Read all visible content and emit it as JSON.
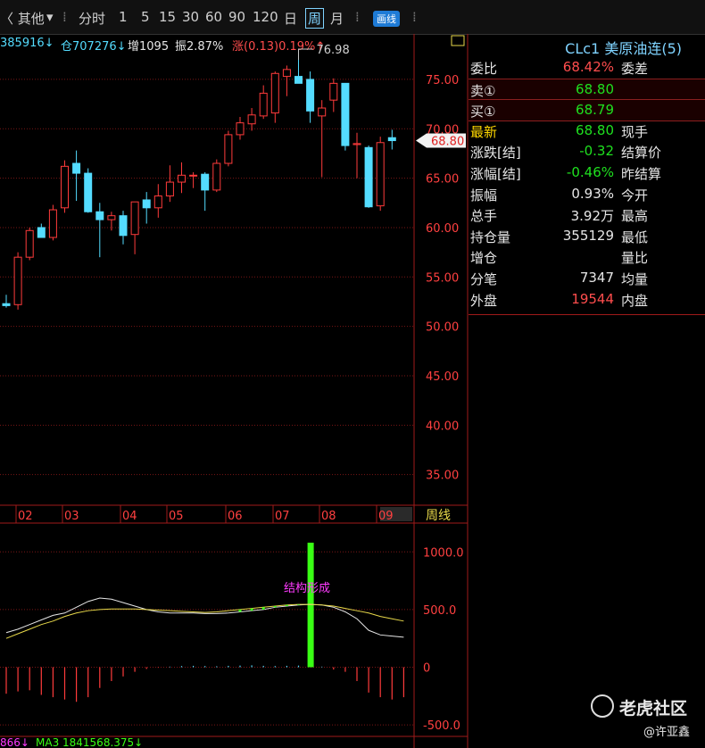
{
  "toolbar": {
    "items": [
      "〈 其他",
      "▾",
      "⁞",
      "分时",
      "1",
      "5",
      "15",
      "30",
      "60",
      "90",
      "120",
      "日",
      "周",
      "月",
      "⁞",
      "画线",
      "⁞"
    ],
    "active": "周"
  },
  "infobar": {
    "vol": "385916↓",
    "oi": "仓707276↓",
    "inc": "增1095",
    "amp": "振2.87%",
    "chg": "涨(0.13)0.19%↑"
  },
  "colors": {
    "up": "#ff3b3b",
    "down": "#54dcff",
    "grid": "#7a1616",
    "ma_white": "#e6e6e6",
    "ma_yellow": "#e8d94a",
    "green_bar": "#39ff14",
    "quote_red": "#ff4d4d",
    "quote_green": "#1fe11f",
    "label_yellow": "#ffd700"
  },
  "chart_data": [
    {
      "type": "candlestick",
      "title": "",
      "x_ticks": [
        "02",
        "03",
        "04",
        "05",
        "06",
        "07",
        "08",
        "09"
      ],
      "period_label": "周线",
      "y_ticks": [
        "75.00",
        "70.00",
        "65.00",
        "60.00",
        "55.00",
        "50.00",
        "45.00",
        "40.00",
        "35.00"
      ],
      "ylim": [
        31.9,
        79.6
      ],
      "max_annotation": "76.98",
      "last_price_tag": "68.80",
      "candles": [
        {
          "o": 52.3,
          "h": 53.2,
          "l": 51.9,
          "c": 52.1
        },
        {
          "o": 52.2,
          "h": 57.5,
          "l": 51.7,
          "c": 57.0
        },
        {
          "o": 57.0,
          "h": 60.0,
          "l": 56.7,
          "c": 59.7
        },
        {
          "o": 60.0,
          "h": 60.4,
          "l": 59.0,
          "c": 59.0
        },
        {
          "o": 59.0,
          "h": 62.3,
          "l": 58.7,
          "c": 61.8
        },
        {
          "o": 62.0,
          "h": 66.8,
          "l": 61.5,
          "c": 66.2
        },
        {
          "o": 66.5,
          "h": 67.8,
          "l": 62.7,
          "c": 65.5
        },
        {
          "o": 65.5,
          "h": 66.0,
          "l": 61.5,
          "c": 61.6
        },
        {
          "o": 61.6,
          "h": 62.5,
          "l": 57.0,
          "c": 60.8
        },
        {
          "o": 60.8,
          "h": 61.6,
          "l": 59.7,
          "c": 61.2
        },
        {
          "o": 61.2,
          "h": 61.7,
          "l": 58.3,
          "c": 59.2
        },
        {
          "o": 59.3,
          "h": 62.6,
          "l": 57.3,
          "c": 62.6
        },
        {
          "o": 62.8,
          "h": 63.6,
          "l": 60.4,
          "c": 62.0
        },
        {
          "o": 62.0,
          "h": 64.4,
          "l": 61.0,
          "c": 63.2
        },
        {
          "o": 63.2,
          "h": 66.3,
          "l": 62.6,
          "c": 64.6
        },
        {
          "o": 64.6,
          "h": 66.6,
          "l": 63.5,
          "c": 65.3
        },
        {
          "o": 65.3,
          "h": 65.6,
          "l": 64.0,
          "c": 65.3
        },
        {
          "o": 65.4,
          "h": 65.6,
          "l": 61.7,
          "c": 63.8
        },
        {
          "o": 63.8,
          "h": 66.9,
          "l": 63.6,
          "c": 66.5
        },
        {
          "o": 66.5,
          "h": 69.8,
          "l": 66.2,
          "c": 69.4
        },
        {
          "o": 69.4,
          "h": 71.2,
          "l": 68.9,
          "c": 70.6
        },
        {
          "o": 70.5,
          "h": 72.1,
          "l": 69.8,
          "c": 71.4
        },
        {
          "o": 71.3,
          "h": 74.4,
          "l": 71.0,
          "c": 73.6
        },
        {
          "o": 71.6,
          "h": 75.8,
          "l": 70.6,
          "c": 75.6
        },
        {
          "o": 75.3,
          "h": 76.4,
          "l": 73.3,
          "c": 76.0
        },
        {
          "o": 75.3,
          "h": 76.98,
          "l": 74.6,
          "c": 74.6
        },
        {
          "o": 75.0,
          "h": 75.8,
          "l": 70.6,
          "c": 71.8
        },
        {
          "o": 71.3,
          "h": 72.9,
          "l": 65.1,
          "c": 72.1
        },
        {
          "o": 72.9,
          "h": 75.1,
          "l": 71.7,
          "c": 74.6
        },
        {
          "o": 74.6,
          "h": 74.6,
          "l": 67.8,
          "c": 68.3
        },
        {
          "o": 68.4,
          "h": 69.6,
          "l": 65.0,
          "c": 68.5
        },
        {
          "o": 68.1,
          "h": 68.3,
          "l": 62.0,
          "c": 62.1
        },
        {
          "o": 62.2,
          "h": 69.2,
          "l": 61.7,
          "c": 68.6
        },
        {
          "o": 69.1,
          "h": 69.9,
          "l": 67.9,
          "c": 68.8
        }
      ]
    },
    {
      "type": "macd",
      "y_ticks": [
        "1000.0",
        "500.0",
        "0",
        "-500.0"
      ],
      "ylim": [
        -600,
        1250
      ],
      "annotation": "结构形成",
      "bottom_left_text": "866↓",
      "bottom_label": "MA3 1841568.375↓",
      "histogram": [
        -230,
        -210,
        -200,
        -240,
        -260,
        -280,
        -300,
        -260,
        -180,
        -120,
        -80,
        -40,
        -15,
        -5,
        5,
        10,
        12,
        10,
        8,
        12,
        14,
        16,
        12,
        10,
        12,
        14,
        10,
        5,
        -20,
        -40,
        -120,
        -220,
        -260,
        -280,
        -260
      ],
      "green_spike": {
        "index": 26,
        "value": 1080
      },
      "line_white": [
        300,
        330,
        370,
        410,
        450,
        470,
        520,
        570,
        600,
        590,
        560,
        530,
        500,
        480,
        470,
        470,
        470,
        465,
        465,
        470,
        480,
        490,
        500,
        520,
        530,
        540,
        545,
        540,
        520,
        480,
        420,
        320,
        280,
        270,
        260
      ],
      "line_yellow": [
        250,
        290,
        330,
        370,
        400,
        440,
        470,
        490,
        500,
        505,
        505,
        505,
        500,
        495,
        490,
        485,
        480,
        475,
        480,
        490,
        500,
        510,
        520,
        530,
        540,
        545,
        545,
        540,
        530,
        510,
        490,
        470,
        440,
        420,
        400
      ]
    }
  ],
  "quote": {
    "header": "CLc1 美原油连(5)",
    "rows": [
      {
        "label": "委比",
        "value": "68.42%",
        "label2": "委差",
        "color": "quote_red"
      },
      {
        "label": "卖①",
        "value": "68.80",
        "label2": "",
        "color": "quote_green",
        "hl": true
      },
      {
        "label": "买①",
        "value": "68.79",
        "label2": "",
        "color": "quote_green",
        "hl": true
      },
      {
        "label": "最新",
        "value": "68.80",
        "label2": "现手",
        "color": "quote_green",
        "lcolor": "label_yellow"
      },
      {
        "label": "涨跌[结]",
        "value": "-0.32",
        "label2": "结算价",
        "color": "quote_green"
      },
      {
        "label": "涨幅[结]",
        "value": "-0.46%",
        "label2": "昨结算",
        "color": "quote_green"
      },
      {
        "label": "振幅",
        "value": "0.93%",
        "label2": "今开",
        "color": "white"
      },
      {
        "label": "总手",
        "value": "3.92万",
        "label2": "最高",
        "color": "white"
      },
      {
        "label": "持仓量",
        "value": "355129",
        "label2": "最低",
        "color": "white"
      },
      {
        "label": "增仓",
        "value": "",
        "label2": "量比",
        "color": "white"
      },
      {
        "label": "分笔",
        "value": "7347",
        "label2": "均量",
        "color": "white"
      },
      {
        "label": "外盘",
        "value": "19544",
        "label2": "内盘",
        "color": "quote_red"
      }
    ]
  },
  "watermark": {
    "brand": "老虎社区",
    "user": "@许亚鑫"
  }
}
